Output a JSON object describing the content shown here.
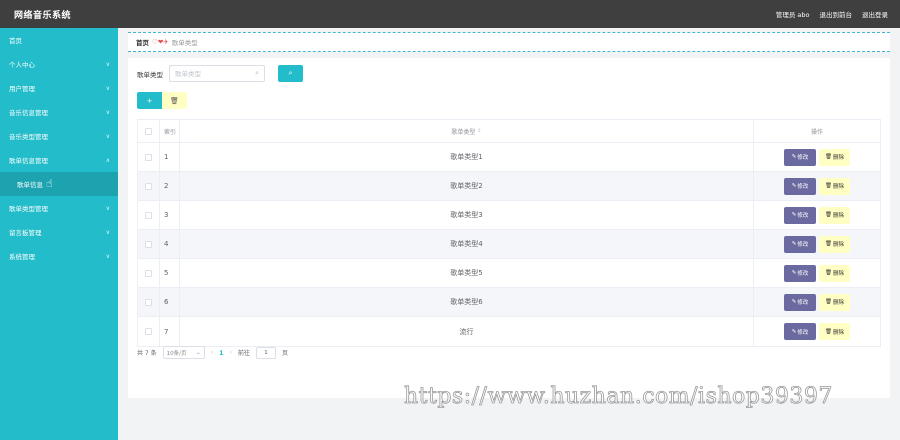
{
  "app": {
    "title": "网络音乐系统",
    "admin_label": "管理员 abo",
    "back_label": "退出到前台",
    "logout_label": "退出登录"
  },
  "sidebar": {
    "items": [
      {
        "label": "首页",
        "chevron": ""
      },
      {
        "label": "个人中心",
        "chevron": "∨"
      },
      {
        "label": "用户管理",
        "chevron": "∨"
      },
      {
        "label": "音乐信息管理",
        "chevron": "∨"
      },
      {
        "label": "音乐类型管理",
        "chevron": "∨"
      },
      {
        "label": "歌单信息管理",
        "chevron": "∧"
      },
      {
        "label": "歌单信息",
        "chevron": ""
      },
      {
        "label": "歌单类型管理",
        "chevron": "∨"
      },
      {
        "label": "留言板管理",
        "chevron": "∨"
      },
      {
        "label": "系统管理",
        "chevron": "∨"
      }
    ]
  },
  "breadcrumb": {
    "home": "首页",
    "separator": "♡❤✈",
    "current": "歌单类型"
  },
  "search": {
    "label": "歌单类型",
    "placeholder": "歌单类型",
    "search_icon": "search-icon"
  },
  "table": {
    "header": {
      "index": "索引",
      "name": "歌单类型",
      "op": "操作"
    },
    "edit_label": "修改",
    "delete_label": "删除",
    "rows": [
      {
        "index": "1",
        "name": "歌单类型1"
      },
      {
        "index": "2",
        "name": "歌单类型2"
      },
      {
        "index": "3",
        "name": "歌单类型3"
      },
      {
        "index": "4",
        "name": "歌单类型4"
      },
      {
        "index": "5",
        "name": "歌单类型5"
      },
      {
        "index": "6",
        "name": "歌单类型6"
      },
      {
        "index": "7",
        "name": "流行"
      }
    ]
  },
  "pagination": {
    "total": "共 7 条",
    "page_size": "10条/页",
    "current_page": "1",
    "goto_label": "前往",
    "goto_value": "1",
    "page_suffix": "页"
  },
  "watermark": "https://www.huzhan.com/ishop39397",
  "colors": {
    "accent": "#23bcca",
    "topbar": "#3f3f3f",
    "edit": "#6a6aa0",
    "delete": "#ffffc4"
  }
}
